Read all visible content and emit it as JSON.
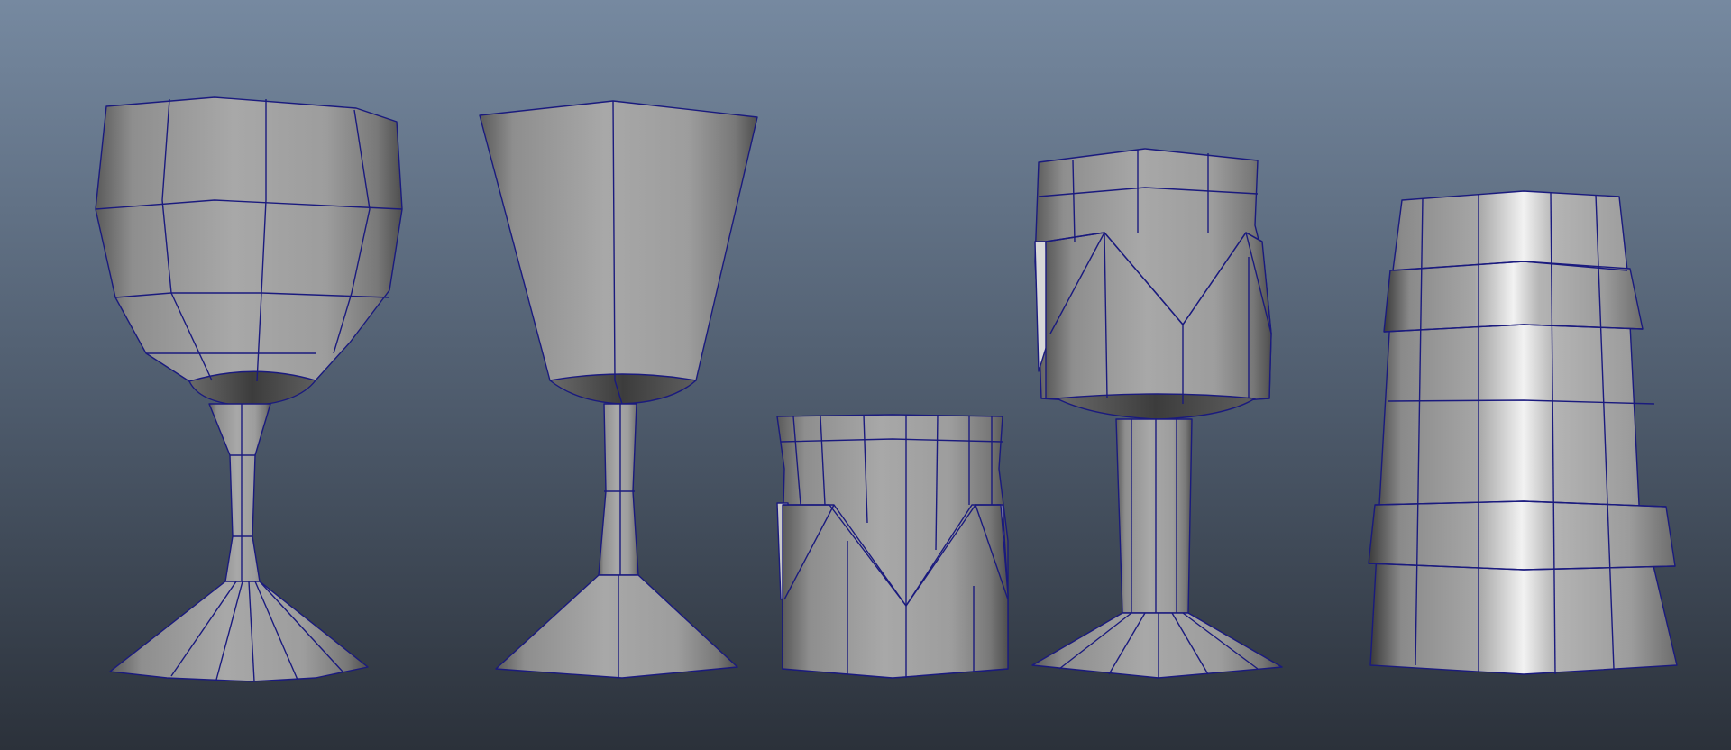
{
  "viewport": {
    "name": "3d-modeling-viewport",
    "background_top": "#7689a0",
    "background_bottom": "#2b313a",
    "wire_color": "#1a1a7e",
    "base_shade": "#a2a2a2",
    "dark_shade": "#4e4e4e",
    "highlight": "#ffffff"
  },
  "models": [
    {
      "name": "goblet-faceted-bowl",
      "kind": "wine-goblet",
      "selected": false
    },
    {
      "name": "chalice-tapered",
      "kind": "chalice",
      "selected": false
    },
    {
      "name": "crown-cup",
      "kind": "cup-with-zigzag-band",
      "selected": false
    },
    {
      "name": "crown-goblet",
      "kind": "goblet-with-zigzag-band",
      "selected": false
    },
    {
      "name": "banded-tumbler",
      "kind": "tall-tumbler-with-rings",
      "selected": false
    }
  ]
}
